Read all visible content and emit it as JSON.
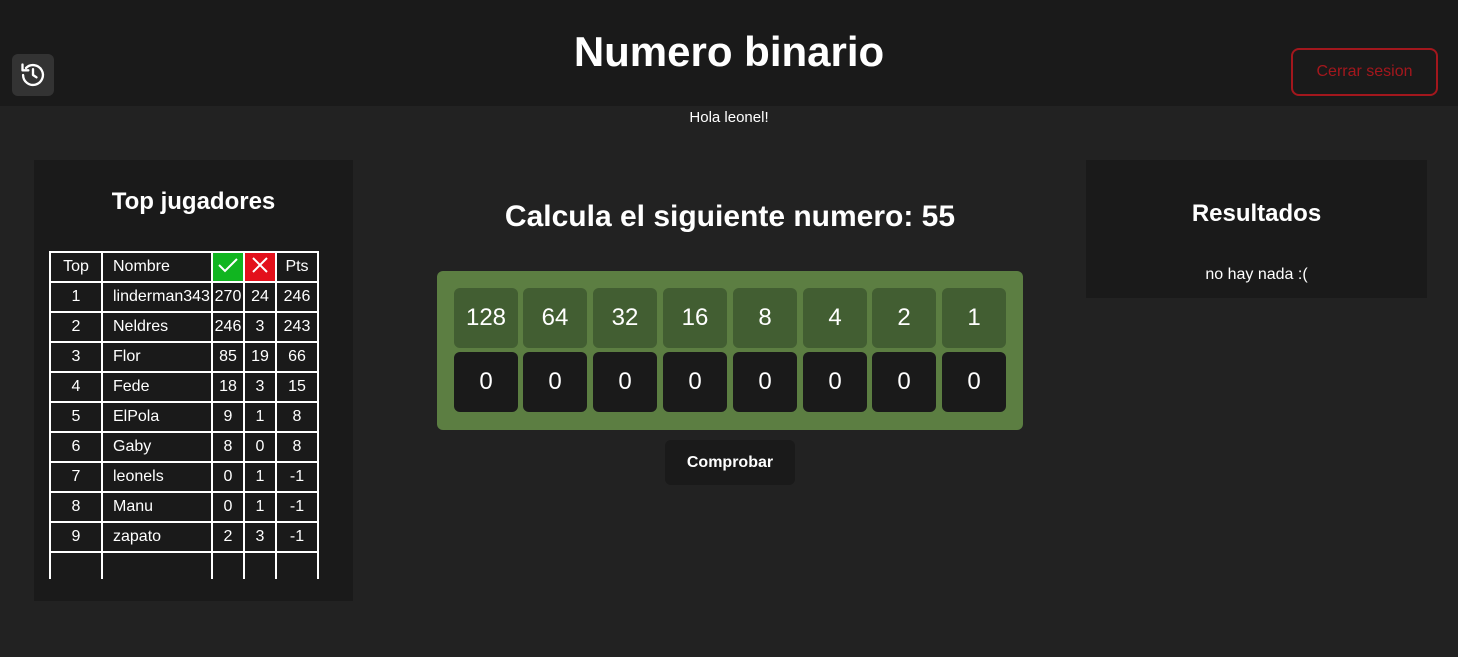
{
  "header": {
    "title": "Numero binario",
    "logout_label": "Cerrar sesion",
    "history_icon": "history-icon"
  },
  "greeting": "Hola leonel!",
  "leaderboard": {
    "title": "Top jugadores",
    "columns": [
      "Top",
      "Nombre",
      "✓",
      "✕",
      "Pts"
    ],
    "rows": [
      {
        "top": "1",
        "name": "linderman343",
        "ok": "270",
        "bad": "24",
        "pts": "246"
      },
      {
        "top": "2",
        "name": "Neldres",
        "ok": "246",
        "bad": "3",
        "pts": "243"
      },
      {
        "top": "3",
        "name": "Flor",
        "ok": "85",
        "bad": "19",
        "pts": "66"
      },
      {
        "top": "4",
        "name": "Fede",
        "ok": "18",
        "bad": "3",
        "pts": "15"
      },
      {
        "top": "5",
        "name": "ElPola",
        "ok": "9",
        "bad": "1",
        "pts": "8"
      },
      {
        "top": "6",
        "name": "Gaby",
        "ok": "8",
        "bad": "0",
        "pts": "8"
      },
      {
        "top": "7",
        "name": "leonels",
        "ok": "0",
        "bad": "1",
        "pts": "-1"
      },
      {
        "top": "8",
        "name": "Manu",
        "ok": "0",
        "bad": "1",
        "pts": "-1"
      },
      {
        "top": "9",
        "name": "zapato",
        "ok": "2",
        "bad": "3",
        "pts": "-1"
      }
    ]
  },
  "game": {
    "question": "Calcula el siguiente numero: 55",
    "place_values": [
      "128",
      "64",
      "32",
      "16",
      "8",
      "4",
      "2",
      "1"
    ],
    "bits": [
      "0",
      "0",
      "0",
      "0",
      "0",
      "0",
      "0",
      "0"
    ],
    "check_label": "Comprobar"
  },
  "results": {
    "title": "Resultados",
    "empty_message": "no hay nada :("
  },
  "colors": {
    "background": "#222222",
    "panel": "#1a1a1a",
    "board": "#5c7e42",
    "place_cell": "#425e32",
    "logout": "#a3171d",
    "correct": "#11b520",
    "wrong": "#e3101b"
  }
}
